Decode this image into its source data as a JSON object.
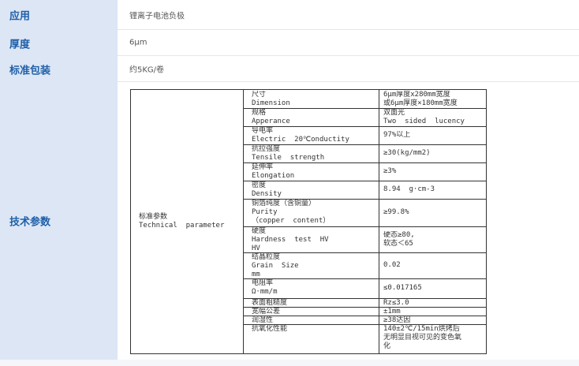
{
  "rows": [
    {
      "label": "应用",
      "value": "锂离子电池负极"
    },
    {
      "label": "厚度",
      "value": "6μm"
    },
    {
      "label": "标准包装",
      "value": "约5KG/卷"
    }
  ],
  "tech": {
    "label": "技术参数",
    "category": "标准参数\nTechnical  parameter",
    "specs": [
      {
        "name": "尺寸\nDimension",
        "value": "6μm厚度x280mm宽度\n或6μm厚度×180mm宽度"
      },
      {
        "name": "规格\nApperance",
        "value": "双面光\nTwo  sided  lucency"
      },
      {
        "name": "导电率\nElectric  20℃onductity",
        "value": "97%以上"
      },
      {
        "name": "抗拉强度\nTensile  strength",
        "value": "≥30(kg/mm2)"
      },
      {
        "name": "延伸率\nElongation",
        "value": "≥3%"
      },
      {
        "name": "密度\nDensity",
        "value": "8.94  g·cm-3"
      },
      {
        "name": "铜箔纯度（含铜量）\nPurity\n（copper  content）",
        "value": "≥99.8%"
      },
      {
        "name": "硬度\nHardness  test  HV\nHV",
        "value": "硬态≥80,\n软态＜65"
      },
      {
        "name": "结晶粒度\nGrain  Size\nmm",
        "value": "0.02"
      },
      {
        "name": "电阻率\nΩ·mm/m",
        "value": "≤0.017165"
      },
      {
        "name": "表面粗糙度",
        "value": "Rz≤3.0"
      },
      {
        "name": "宽幅公差",
        "value": "±1mm"
      },
      {
        "name": "润湿性",
        "value": "≥38达因"
      },
      {
        "name": "抗氧化性能",
        "value": "140±2℃/15min烘烤后\n无明显目视可见的变色氧\n化"
      }
    ]
  }
}
